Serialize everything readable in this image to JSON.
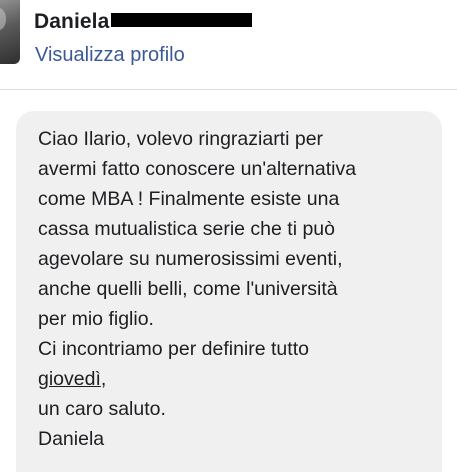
{
  "sender": {
    "first_name": "Daniela",
    "profile_link_label": "Visualizza profilo"
  },
  "message": {
    "lines": [
      "Ciao Ilario, volevo ringraziarti per",
      "avermi fatto conoscere un'alternativa",
      "come MBA ! Finalmente esiste una",
      "cassa mutualistica serie che ti può",
      "agevolare su numerosissimi eventi,",
      "anche quelli belli, come l'università",
      "per mio figlio.",
      "Ci incontriamo per definire tutto"
    ],
    "date_link": "giovedì",
    "date_suffix": ",",
    "closing_lines": [
      "un caro saluto.",
      "Daniela"
    ]
  },
  "colors": {
    "link": "#3b5998",
    "bubble": "#f1f0f0",
    "text": "#1c1e21",
    "redaction": "#000000"
  },
  "icons": {
    "avatar": "profile-photo"
  }
}
